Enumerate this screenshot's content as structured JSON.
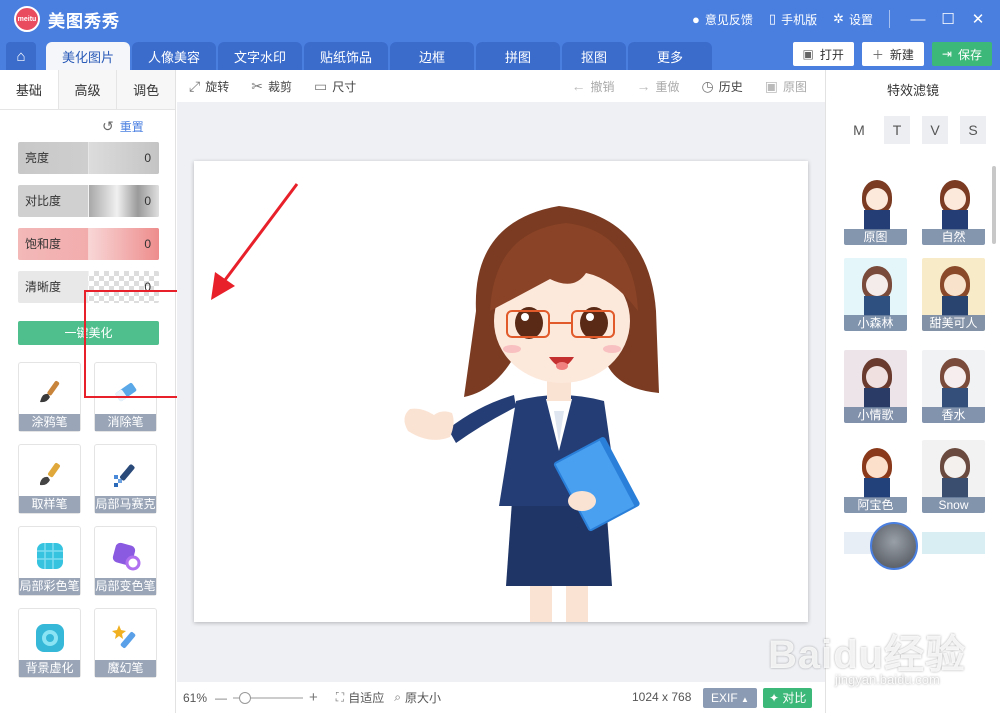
{
  "app": {
    "title": "美图秀秀",
    "logo_text": "meitu"
  },
  "titlebar": {
    "feedback": "意见反馈",
    "mobile": "手机版",
    "settings": "设置"
  },
  "tabs": [
    "美化图片",
    "人像美容",
    "文字水印",
    "贴纸饰品",
    "边框",
    "拼图",
    "抠图",
    "更多"
  ],
  "actions": {
    "open": "打开",
    "new": "新建",
    "save": "保存"
  },
  "left_panel": {
    "subtabs": [
      "基础",
      "高级",
      "调色"
    ],
    "reset": "重置",
    "sliders": [
      {
        "label": "亮度",
        "value": "0"
      },
      {
        "label": "对比度",
        "value": "0"
      },
      {
        "label": "饱和度",
        "value": "0"
      },
      {
        "label": "清晰度",
        "value": "0"
      }
    ],
    "one_key": "一键美化",
    "tools": [
      "涂鸦笔",
      "消除笔",
      "取样笔",
      "局部马赛克",
      "局部彩色笔",
      "局部变色笔",
      "背景虚化",
      "魔幻笔"
    ]
  },
  "toolbar": {
    "rotate": "旋转",
    "crop": "裁剪",
    "size": "尺寸",
    "undo": "撤销",
    "redo": "重做",
    "history": "历史",
    "original": "原图"
  },
  "bottombar": {
    "zoom": "61%",
    "fit": "自适应",
    "original_size": "原大小",
    "dimensions": "1024 x 768",
    "exif": "EXIF",
    "compare": "对比"
  },
  "right_panel": {
    "title": "特效滤镜",
    "filter_tabs": [
      "M",
      "T",
      "V",
      "S"
    ],
    "filters": [
      "原图",
      "自然",
      "小森林",
      "甜美可人",
      "小情歌",
      "香水",
      "阿宝色",
      "Snow"
    ]
  },
  "watermark": {
    "brand": "Baidu经验",
    "url": "jingyan.baidu.com"
  },
  "colors": {
    "accent": "#4a7fe0",
    "save_green": "#3cb878",
    "highlight_red": "#e8202a"
  }
}
